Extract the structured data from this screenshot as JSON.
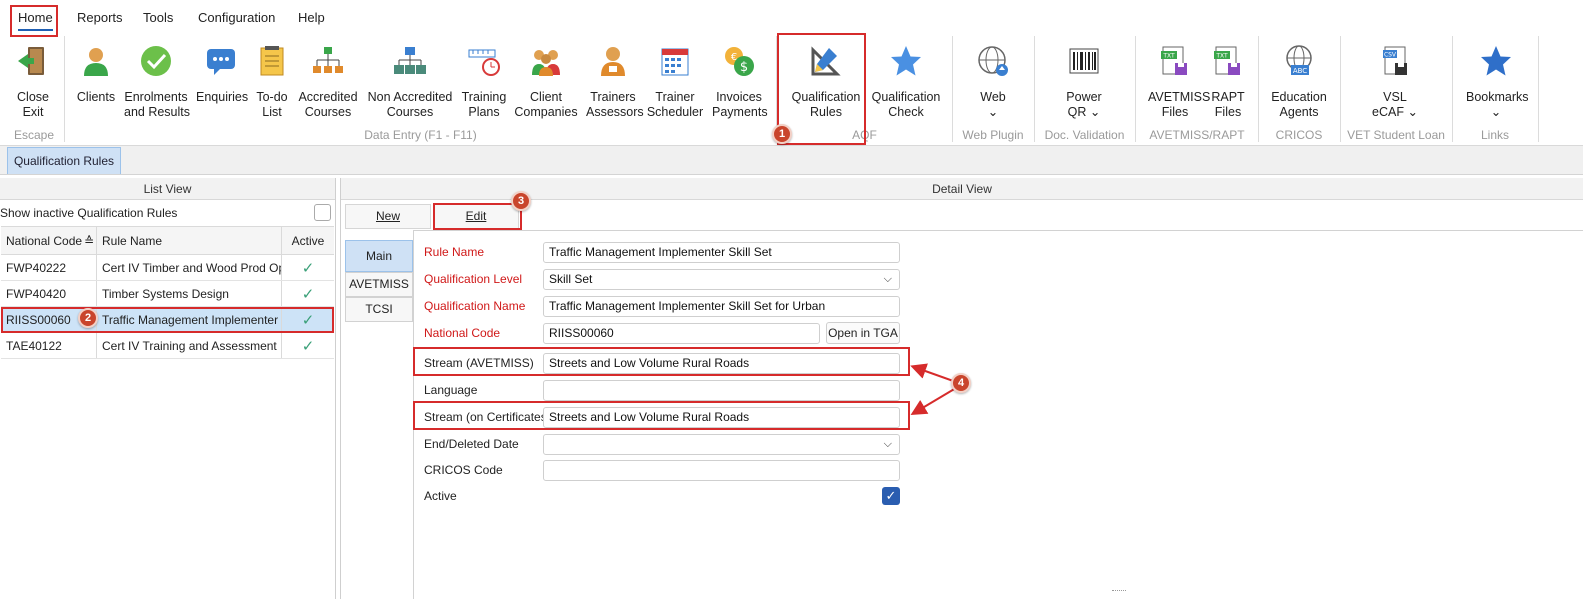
{
  "menu": {
    "home": "Home",
    "reports": "Reports",
    "tools": "Tools",
    "configuration": "Configuration",
    "help": "Help"
  },
  "ribbon": {
    "close_l1": "Close",
    "close_l2": "Exit",
    "clients": "Clients",
    "enrol_l1": "Enrolments",
    "enrol_l2": "and Results",
    "enquiries": "Enquiries",
    "todo_l1": "To-do",
    "todo_l2": "List",
    "acc_l1": "Accredited",
    "acc_l2": "Courses",
    "nonacc_l1": "Non Accredited",
    "nonacc_l2": "Courses",
    "plans_l1": "Training",
    "plans_l2": "Plans",
    "client_co_l1": "Client",
    "client_co_l2": "Companies",
    "trainers_l1": "Trainers",
    "trainers_l2": "Assessors",
    "sched_l1": "Trainer",
    "sched_l2": "Scheduler",
    "inv_l1": "Invoices",
    "inv_l2": "Payments",
    "qrules_l1": "Qualification",
    "qrules_l2": "Rules",
    "qcheck_l1": "Qualification",
    "qcheck_l2": "Check",
    "web": "Web",
    "power_l1": "Power",
    "power_l2": "QR",
    "avfiles_l1": "AVETMISS",
    "avfiles_l2": "Files",
    "rapt_l1": "RAPT",
    "rapt_l2": "Files",
    "edu_l1": "Education",
    "edu_l2": "Agents",
    "vsl_l1": "VSL",
    "vsl_l2": "eCAF",
    "bookmarks": "Bookmarks",
    "groups": {
      "escape": "Escape",
      "data_entry": "Data Entry (F1 - F11)",
      "aqf": "AQF",
      "web_plugin": "Web Plugin",
      "doc_validation": "Doc. Validation",
      "avetmiss_rapt": "AVETMISS/RAPT",
      "cricos": "CRICOS",
      "vet": "VET Student Loan",
      "links": "Links"
    },
    "icon_colors": {
      "blue": "#2f6fc9",
      "green": "#3aa64a",
      "orange": "#e08a2c",
      "red": "#d83a3a"
    }
  },
  "doc_tab": "Qualification Rules",
  "list_view": {
    "title": "List View",
    "show_inactive": "Show inactive Qualification Rules",
    "columns": [
      "National Code",
      "Rule Name",
      "Active"
    ],
    "rows": [
      {
        "code": "FWP40222",
        "name": "Cert IV Timber and Wood Prod Oper",
        "active": "✓"
      },
      {
        "code": "FWP40420",
        "name": "Timber Systems Design",
        "active": "✓"
      },
      {
        "code": "RIISS00060",
        "name": "Traffic Management Implementer Sk",
        "active": "✓"
      },
      {
        "code": "TAE40122",
        "name": "Cert IV Training and Assessment",
        "active": "✓"
      }
    ]
  },
  "detail_view": {
    "title": "Detail View",
    "new_btn": "New",
    "edit_btn": "Edit",
    "tabs": [
      "Main",
      "AVETMISS",
      "TCSI"
    ],
    "fields": {
      "rule_name_label": "Rule Name",
      "rule_name": "Traffic Management Implementer Skill Set",
      "qual_level_label": "Qualification Level",
      "qual_level": "Skill Set",
      "qual_name_label": "Qualification Name",
      "qual_name": "Traffic Management Implementer Skill Set for Urban",
      "nat_code_label": "National Code",
      "nat_code": "RIISS00060",
      "open_tga": "Open in TGA",
      "stream_av_label": "Stream (AVETMISS)",
      "stream_av": "Streets and Low Volume Rural Roads",
      "language_label": "Language",
      "language": "",
      "stream_cert_label": "Stream (on Certificates)",
      "stream_cert": "Streets and Low Volume Rural Roads",
      "end_date_label": "End/Deleted Date",
      "end_date": "",
      "cricos_label": "CRICOS Code",
      "cricos": "",
      "active_label": "Active",
      "active_check": "✓"
    }
  },
  "annotations": {
    "b1": "1",
    "b2": "2",
    "b3": "3",
    "b4": "4",
    "color": "#d62b2b"
  }
}
